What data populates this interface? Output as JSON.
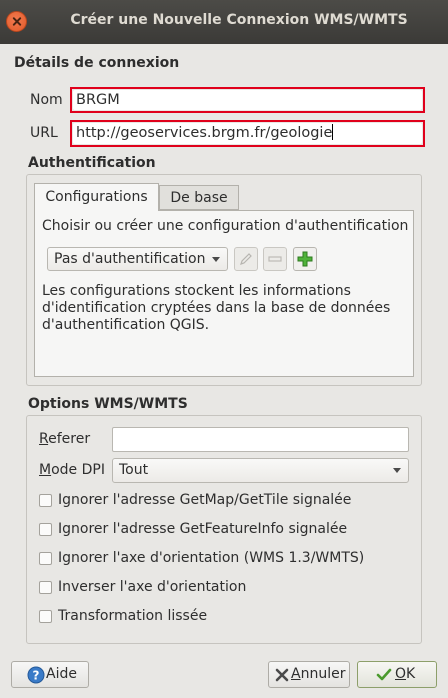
{
  "window": {
    "title": "Créer une Nouvelle Connexion WMS/WMTS"
  },
  "connection": {
    "group_title": "Détails de connexion",
    "name_label": "Nom",
    "name_value": "BRGM",
    "url_label": "URL",
    "url_value": "http://geoservices.brgm.fr/geologie"
  },
  "auth": {
    "group_title": "Authentification",
    "tabs": [
      {
        "label": "Configurations",
        "active": true
      },
      {
        "label": "De base",
        "active": false
      }
    ],
    "instruction": "Choisir ou créer une configuration d'authentification",
    "config_select": "Pas d'authentification",
    "edit_icon": "pencil-icon",
    "remove_icon": "minus-icon",
    "add_icon": "plus-icon",
    "info_text": "Les configurations stockent les informations d'identification cryptées dans la base de données d'authentification QGIS."
  },
  "options": {
    "group_title": "Options WMS/WMTS",
    "referer_label": "Referer",
    "referer_value": "",
    "dpi_label": "Mode DPI",
    "dpi_value": "Tout",
    "checkboxes": [
      {
        "label": "Ignorer l'adresse GetMap/GetTile signalée",
        "checked": false
      },
      {
        "label": "Ignorer l'adresse GetFeatureInfo signalée",
        "checked": false
      },
      {
        "label": "Ignorer l'axe d'orientation (WMS 1.3/WMTS)",
        "checked": false
      },
      {
        "label": "Inverser l'axe d'orientation",
        "checked": false
      },
      {
        "label": "Transformation lissée",
        "checked": false
      }
    ]
  },
  "buttons": {
    "help_label": "Aide",
    "cancel_label": "Annuler",
    "ok_label": "OK"
  },
  "colors": {
    "highlight_border": "#e0001b",
    "add_icon_green": "#3d9b2c"
  }
}
